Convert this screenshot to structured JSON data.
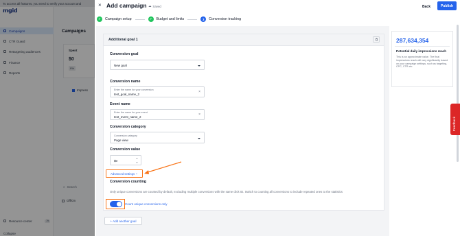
{
  "background_app": {
    "banner": "To access all features, you need to verify your account and",
    "logo": "mgid",
    "nav": [
      {
        "label": "Campaigns",
        "active": true
      },
      {
        "label": "CTR Guard",
        "active": false
      },
      {
        "label": "Retargeting audiences",
        "active": false
      },
      {
        "label": "Finance",
        "active": false
      },
      {
        "label": "Reports",
        "active": false
      }
    ],
    "resource_center": "Resource center",
    "resource_badge": "79",
    "collapse": "Collapse",
    "page_title": "Campaigns",
    "spent_label": "Spent",
    "spent_value": "$0",
    "spent_pct": "0%",
    "impressions_label": "Impress",
    "search_label": "Search",
    "off_on_label": "Off/On"
  },
  "modal": {
    "close_icon": "close-icon",
    "title": "Add campaign",
    "saved_text": "Saved",
    "back_label": "Back",
    "publish_label": "Publish",
    "steps": [
      {
        "label": "Campaign setup",
        "status": "done",
        "marker": "✓"
      },
      {
        "label": "Budget and limits",
        "status": "done",
        "marker": "✓"
      },
      {
        "label": "Conversion tracking",
        "status": "active",
        "marker": "3"
      }
    ]
  },
  "goal_card": {
    "title": "Additional goal 1",
    "conversion_goal": {
      "label": "Conversion goal",
      "value": "New goal"
    },
    "conversion_name": {
      "label": "Conversion name",
      "hint": "Enter the name for your conversion",
      "value": "test_goal_name_2"
    },
    "event_name": {
      "label": "Event name",
      "hint": "Enter the name for your event",
      "value": "test_event_name_2"
    },
    "conversion_category": {
      "label": "Conversion category",
      "hint": "Conversion category",
      "value": "Page view"
    },
    "conversion_value": {
      "label": "Conversion value",
      "value": "$0"
    },
    "advanced_settings": "Advanced settings",
    "conversion_counting": {
      "label": "Conversion counting",
      "note": "Only unique conversions are counted by default, excluding multiple conversions with the same click ID. Switch to counting all conversions to include repeated ones to the statistics",
      "toggle_label": "Count unique conversions only",
      "toggle_on": true
    },
    "add_goal_label": "+ Add another goal"
  },
  "reach_panel": {
    "value": "287,634,354",
    "title": "Potential daily impressions reach",
    "description": "This is an approximate value. The final impressions reach will vary significantly based on your campaign settings, such as targeting, CPC, CTR etc."
  },
  "feedback_label": "Feedback",
  "colors": {
    "accent": "#2563eb",
    "success": "#22c55e",
    "highlight": "#f97316",
    "feedback": "#dc2626"
  }
}
